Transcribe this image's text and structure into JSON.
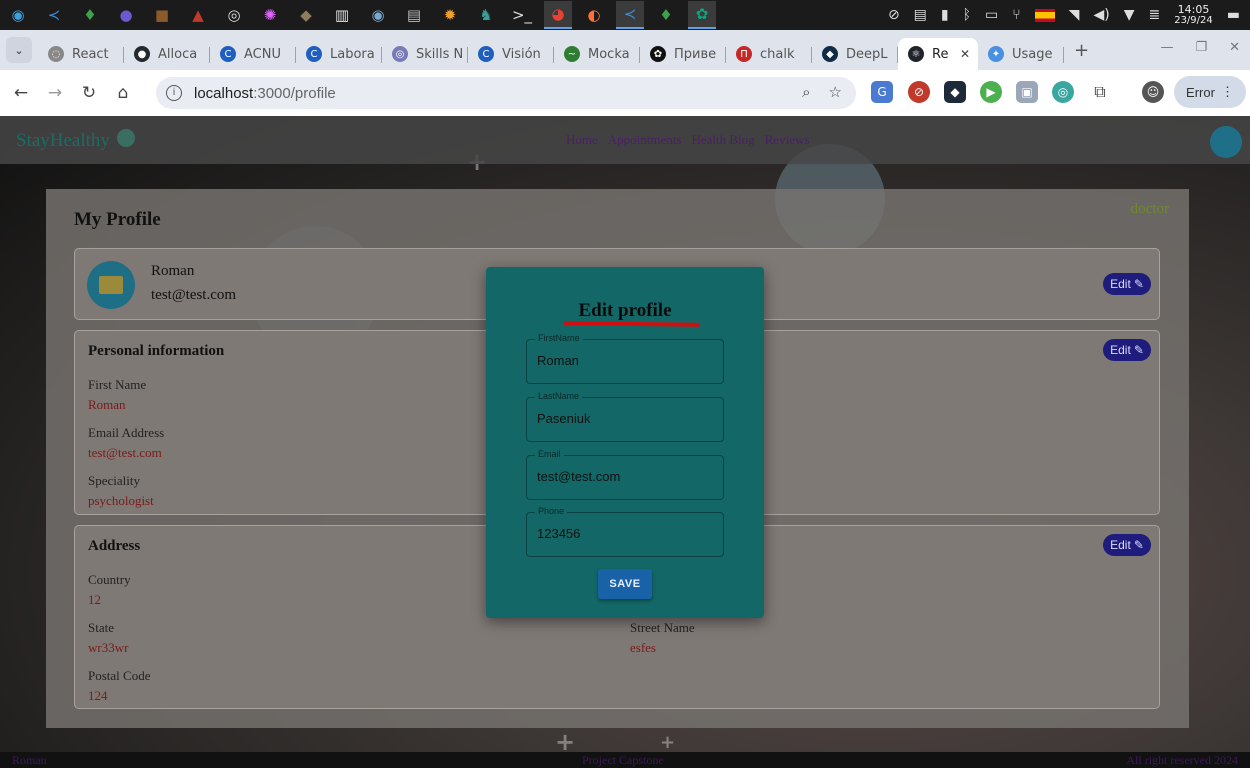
{
  "taskbar": {
    "apps": [
      {
        "name": "app-launcher-icon",
        "glyph": "◉",
        "color": "#3aa0e0"
      },
      {
        "name": "vscode-icon",
        "glyph": "≺",
        "color": "#3b8fd6"
      },
      {
        "name": "mongodb-icon",
        "glyph": "♦",
        "color": "#3ca14a"
      },
      {
        "name": "eclipse-icon",
        "glyph": "●",
        "color": "#6a5acd"
      },
      {
        "name": "minecraft-icon",
        "glyph": "■",
        "color": "#8a5a2b"
      },
      {
        "name": "filezilla-icon",
        "glyph": "▲",
        "color": "#c0392b"
      },
      {
        "name": "obs-icon",
        "glyph": "◎",
        "color": "#dddddd"
      },
      {
        "name": "krita-icon",
        "glyph": "✺",
        "color": "#e066ff"
      },
      {
        "name": "gimp-icon",
        "glyph": "◆",
        "color": "#8c7b5e"
      },
      {
        "name": "file-manager-icon",
        "glyph": "▥",
        "color": "#e2e2e2"
      },
      {
        "name": "disk-icon",
        "glyph": "◉",
        "color": "#7aa6d2"
      },
      {
        "name": "text-editor-icon",
        "glyph": "▤",
        "color": "#bbbbbb"
      },
      {
        "name": "picture-viewer-icon",
        "glyph": "✹",
        "color": "#f0a030"
      },
      {
        "name": "game-icon",
        "glyph": "♞",
        "color": "#3aa09a"
      },
      {
        "name": "terminal-icon",
        "glyph": ">_",
        "color": "#dddddd"
      },
      {
        "name": "chrome-icon",
        "glyph": "◕",
        "color": "#e94235",
        "active": true
      },
      {
        "name": "firefox-icon",
        "glyph": "◐",
        "color": "#ff7139"
      },
      {
        "name": "vscode-icon-2",
        "glyph": "≺",
        "color": "#3b8fd6",
        "active": true
      },
      {
        "name": "mongodb-icon-2",
        "glyph": "♦",
        "color": "#3ca14a"
      },
      {
        "name": "chatgpt-icon",
        "glyph": "✿",
        "color": "#10a37f",
        "active": true
      }
    ],
    "time": "14:05",
    "date": "23/9/24"
  },
  "tabs": [
    {
      "label": "React",
      "fav": "#888888",
      "glyph": "◌"
    },
    {
      "label": "Alloca",
      "fav": "#24292e",
      "glyph": "●"
    },
    {
      "label": "ACNU",
      "fav": "#1f5fbf",
      "glyph": "C"
    },
    {
      "label": "Labora",
      "fav": "#1f5fbf",
      "glyph": "C"
    },
    {
      "label": "Skills N",
      "fav": "#7a7ab8",
      "glyph": "◎"
    },
    {
      "label": "Visión",
      "fav": "#1f5fbf",
      "glyph": "C"
    },
    {
      "label": "Mocka",
      "fav": "#2e7d32",
      "glyph": "~"
    },
    {
      "label": "Приве",
      "fav": "#111111",
      "glyph": "✿"
    },
    {
      "label": "chalk",
      "fav": "#c62828",
      "glyph": "П"
    },
    {
      "label": "DeepL",
      "fav": "#0f2b46",
      "glyph": "◆"
    },
    {
      "label": "Re",
      "fav": "#20232a",
      "glyph": "⚛",
      "active": true
    },
    {
      "label": "Usage",
      "fav": "#4a90e2",
      "glyph": "✦"
    }
  ],
  "address": {
    "host": "localhost",
    "path": ":3000/profile"
  },
  "toolbar": {
    "error_label": "Error"
  },
  "site": {
    "brand": "StayHealthy",
    "nav": [
      "Home",
      "Appointments",
      "Health Blog",
      "Reviews"
    ],
    "role": "doctor"
  },
  "profile": {
    "title": "My Profile",
    "name": "Roman",
    "email": "test@test.com",
    "edit_label": "Edit"
  },
  "personal": {
    "title": "Personal information",
    "first_name_label": "First Name",
    "first_name": "Roman",
    "email_label": "Email Address",
    "email": "test@test.com",
    "speciality_label": "Speciality",
    "speciality": "psychologist"
  },
  "address_card": {
    "title": "Address",
    "country_label": "Country",
    "country": "12",
    "state_label": "State",
    "state": "wr33wr",
    "street_label": "Street Name",
    "street": "esfes",
    "postal_label": "Postal Code",
    "postal": "124"
  },
  "footer": {
    "left": "Roman",
    "center": "Project Capstone",
    "right": "All right reserved 2024"
  },
  "modal": {
    "title": "Edit profile",
    "fields": [
      {
        "label": "FirstName",
        "value": "Roman"
      },
      {
        "label": "LastName",
        "value": "Paseniuk"
      },
      {
        "label": "Email",
        "value": "test@test.com"
      },
      {
        "label": "Phone",
        "value": "123456"
      }
    ],
    "save_label": "SAVE"
  }
}
